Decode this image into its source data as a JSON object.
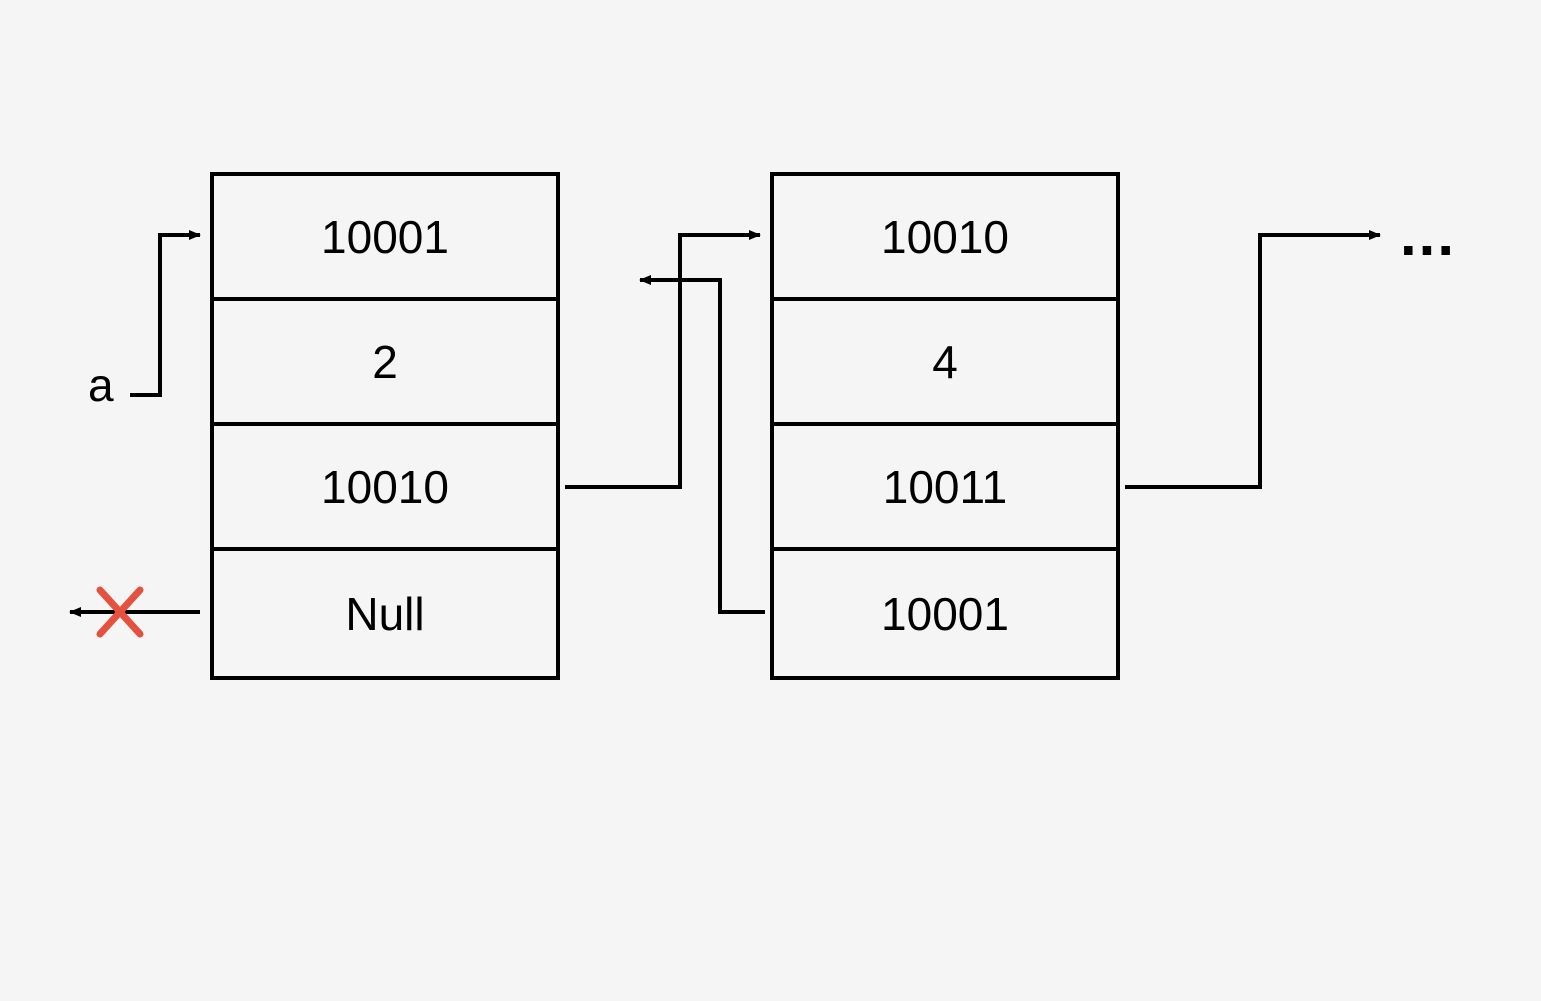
{
  "label_a": "a",
  "ellipsis": "...",
  "node1": {
    "cell1": "10001",
    "cell2": "2",
    "cell3": "10010",
    "cell4": "Null"
  },
  "node2": {
    "cell1": "10010",
    "cell2": "4",
    "cell3": "10011",
    "cell4": "10001"
  },
  "colors": {
    "border": "#000000",
    "bg": "#f5f5f5",
    "null_x": "#e5513f"
  }
}
